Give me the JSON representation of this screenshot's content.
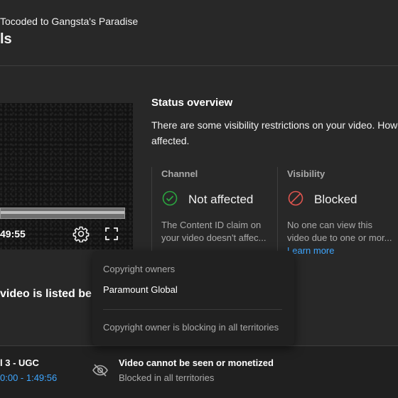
{
  "header": {
    "subtitle": "Tocoded to Gangsta's Paradise",
    "title": "ls"
  },
  "player": {
    "time": "49:55",
    "progress_fraction": 1.0,
    "settings_icon": "gear-icon",
    "fullscreen_icon": "fullscreen-icon"
  },
  "status": {
    "title": "Status overview",
    "description_lines": [
      "There are some visibility restrictions on your video. Howe",
      "affected."
    ],
    "channel": {
      "heading": "Channel",
      "icon": "check-circle-icon",
      "icon_color": "#2ba640",
      "status": "Not affected",
      "lines": [
        "The Content ID claim on",
        "your video doesn't affec..."
      ]
    },
    "visibility": {
      "heading": "Visibility",
      "icon": "blocked-icon",
      "icon_color": "#e0554f",
      "status": "Blocked",
      "lines": [
        "No one can view this",
        "video due to one or mor..."
      ],
      "link": "Learn more"
    }
  },
  "listed_text": "video is listed belo",
  "popup": {
    "heading": "Copyright owners",
    "owner": "Paramount Global",
    "note": "Copyright owner is blocking in all territories"
  },
  "claim_row": {
    "name": "l 3 - UGC",
    "range": "0:00 - 1:49:56",
    "impact_icon": "eye-off-icon",
    "impact_title": "Video cannot be seen or monetized",
    "impact_subtitle": "Blocked in all territories"
  },
  "colors": {
    "background": "#282828",
    "link": "#3ea6ff",
    "popup": "#212121"
  }
}
